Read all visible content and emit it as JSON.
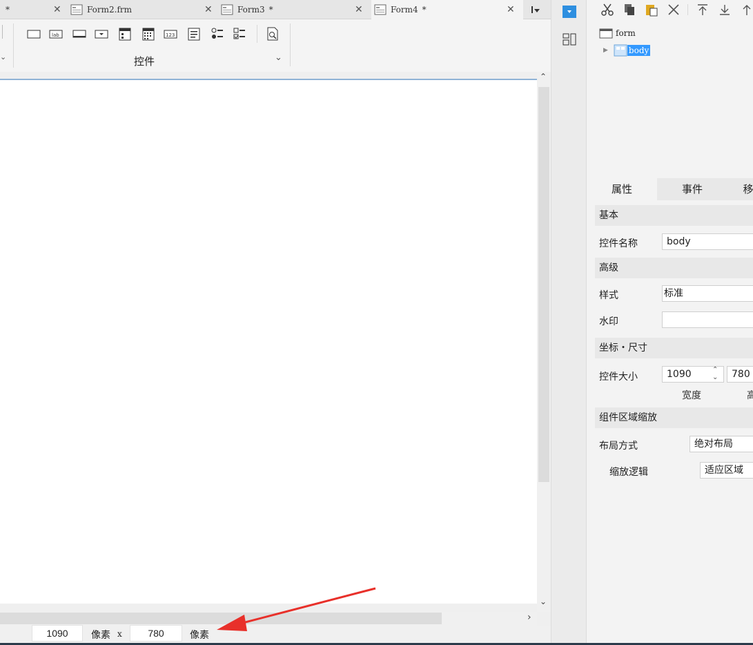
{
  "tabs": [
    {
      "title": "",
      "modified": "*"
    },
    {
      "title": "Form2.frm",
      "modified": ""
    },
    {
      "title": "Form3",
      "modified": "*"
    },
    {
      "title": "Form4",
      "modified": "*"
    }
  ],
  "ribbon": {
    "group_label": "控件",
    "icons": [
      "button-icon",
      "label-icon",
      "textbox-icon",
      "combobox-icon",
      "form-icon",
      "calendar-icon",
      "number-icon",
      "list-icon",
      "radio-group-icon",
      "checkbox-group-icon",
      "preview-icon"
    ]
  },
  "status": {
    "width_value": "1090",
    "width_unit": "像素",
    "separator": "x",
    "height_value": "780",
    "height_unit": "像素"
  },
  "tree": {
    "root": "form",
    "child": "body"
  },
  "properties": {
    "tabs": [
      "属性",
      "事件",
      "移"
    ],
    "sections": {
      "basic": "基本",
      "advanced": "高级",
      "coords": "坐标・尺寸",
      "zoom": "组件区域缩放"
    },
    "control_name_label": "控件名称",
    "control_name_value": "body",
    "style_label": "样式",
    "style_value": "标准",
    "watermark_label": "水印",
    "watermark_value": "",
    "size_label": "控件大小",
    "width_value": "1090",
    "height_value": "780",
    "width_caption": "宽度",
    "height_caption": "高",
    "layout_label": "布局方式",
    "layout_value": "绝对布局",
    "zoom_logic_label": "缩放逻辑",
    "zoom_logic_value": "适应区域"
  },
  "colors": {
    "accent": "#2e8fe0",
    "selection": "#3399ff",
    "arrow": "#e8302a"
  }
}
